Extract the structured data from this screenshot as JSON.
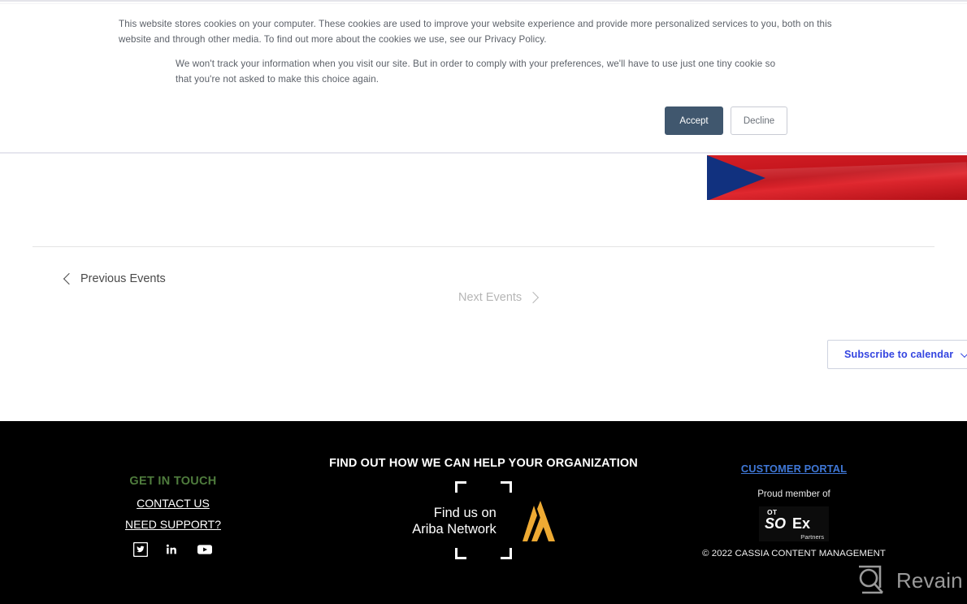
{
  "cookie_banner": {
    "paragraph_1": "This website stores cookies on your computer. These cookies are used to improve your website experience and provide more personalized services to you, both on this website and through other media. To find out more about the cookies we use, see our Privacy Policy.",
    "paragraph_2": "We won't track your information when you visit our site. But in order to comply with your preferences, we'll have to use just one tiny cookie so that you're not asked to make this choice again.",
    "accept_label": "Accept",
    "decline_label": "Decline",
    "accept_color": "#40576e"
  },
  "events_nav": {
    "previous_label": "Previous Events",
    "next_label": "Next Events",
    "previous_icon": "chevron-left-icon",
    "next_icon": "chevron-right-icon",
    "next_disabled_color": "#b6b6b6"
  },
  "subscribe": {
    "label": "Subscribe to calendar",
    "caret_icon": "chevron-down-icon",
    "accent_color": "#3344e0"
  },
  "flag": {
    "name": "czech-republic-flag",
    "blue": "#11317f",
    "red": "#d31f26"
  },
  "footer": {
    "left": {
      "heading": "GET IN TOUCH",
      "heading_color": "#4f7c3d",
      "contact_label": "CONTACT US",
      "support_label": "NEED SUPPORT?",
      "social": [
        {
          "name": "twitter-icon",
          "label": "Twitter"
        },
        {
          "name": "linkedin-icon",
          "label": "LinkedIn"
        },
        {
          "name": "youtube-icon",
          "label": "YouTube"
        }
      ]
    },
    "center": {
      "title": "FIND OUT HOW WE CAN HELP YOUR ORGANIZATION",
      "badge_text": "Find us on\nAriba Network",
      "badge_logo": "ariba-chevron-logo",
      "badge_logo_color": "#eeaa33"
    },
    "right": {
      "portal_label": "CUSTOMER PORTAL",
      "portal_color": "#3f77d6",
      "proud_label": "Proud member of",
      "badge": {
        "ot": "OT",
        "so": "SO",
        "ex": "Ex",
        "partners": "Partners"
      },
      "copyright": "© 2022 CASSIA CONTENT MANAGEMENT"
    }
  },
  "watermark": {
    "label": "Revain",
    "icon": "revain-logo-icon",
    "color": "#9a9a9a"
  }
}
